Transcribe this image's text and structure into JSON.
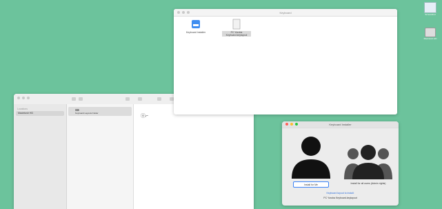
{
  "finder": {
    "sidebar_heading": "Locations",
    "sidebar_item": "Macintosh HD",
    "column_item": "Keyboard Layouts Folder",
    "preview_symbol": "ⓞ⌐"
  },
  "layouts_window": {
    "title": "Keyboard",
    "files": [
      {
        "label": "Keyboard Installer"
      },
      {
        "label": "PC Yoruba Keyboard.keylayout"
      }
    ]
  },
  "installer": {
    "title": "Keyboard Installer",
    "install_me_label": "Install for Me",
    "install_all_label": "Install for all users (Admin rights)",
    "link_text": "Keyboard layout to install:",
    "layout_name": "PC Yoruba Keyboard.keylayout"
  },
  "desktop": {
    "icons": [
      {
        "label": "Screenshot"
      },
      {
        "label": "Macintosh HD"
      }
    ]
  }
}
